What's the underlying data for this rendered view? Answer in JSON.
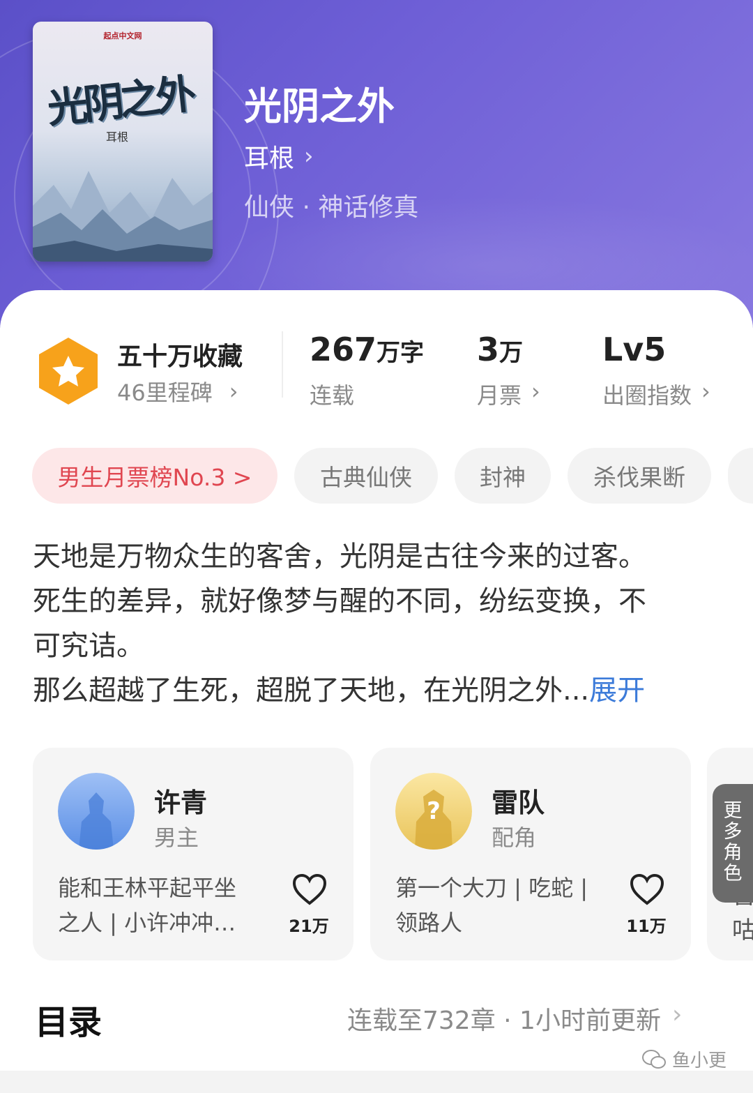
{
  "book": {
    "title": "光阴之外",
    "author": "耳根",
    "genre": "仙侠 · 神话修真",
    "cover": {
      "publisher": "起点中文网",
      "title": "光阴之外",
      "author": "耳根"
    }
  },
  "stats": {
    "favorites": {
      "label": "五十万收藏",
      "sub": "46里程碑"
    },
    "words": {
      "value": "267",
      "unit": "万字",
      "label": "连载"
    },
    "tickets": {
      "value": "3",
      "unit": "万",
      "label": "月票"
    },
    "influence": {
      "value": "Lv5",
      "label": "出圈指数"
    }
  },
  "tags": [
    "男生月票榜No.3 >",
    "古典仙侠",
    "封神",
    "杀伐果断"
  ],
  "synopsis": {
    "lines": [
      "天地是万物众生的客舍，光阴是古往今来的过客。",
      "死生的差异，就好像梦与醒的不同，纷纭变换，不",
      "可究诘。"
    ],
    "last_line": "那么超越了生死，超脱了天地，在光阴之外...",
    "expand": "展开"
  },
  "roles": [
    {
      "name": "许青",
      "type": "男主",
      "desc_line1": "能和王林平起平坐",
      "desc_line2": "之人 | 小许冲冲…",
      "likes": "21万"
    },
    {
      "name": "雷队",
      "type": "配角",
      "desc_line1": "第一个大刀 | 吃蛇 |",
      "desc_line2": "领路人",
      "likes": "11万"
    }
  ],
  "peek_text": [
    "喜",
    "咕"
  ],
  "more_roles": "更多角色",
  "toc": {
    "title": "目录",
    "status": "连载至732章 · 1小时前更新"
  },
  "watermark": "鱼小更",
  "colors": {
    "hero_start": "#5b50c8",
    "hero_end": "#8878e0",
    "rank_tag_bg": "#fde7e8",
    "rank_tag_text": "#e04650",
    "link_blue": "#3c7bd9",
    "badge_orange": "#f7a21b"
  }
}
